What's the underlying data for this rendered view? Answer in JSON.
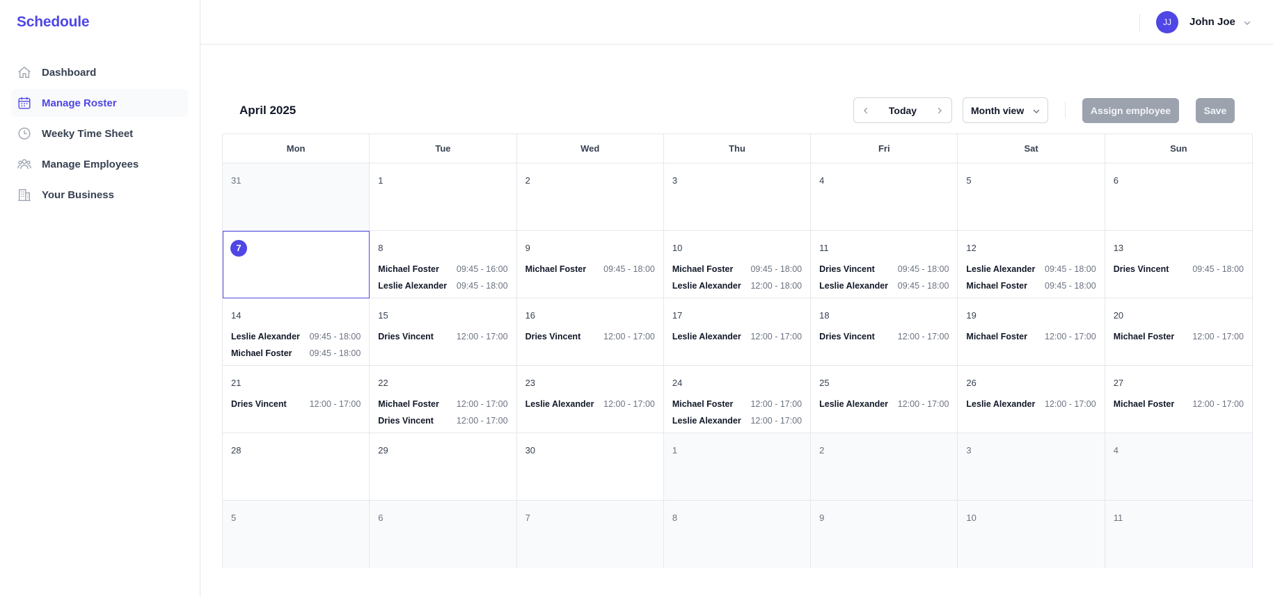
{
  "app": {
    "name": "Schedoule"
  },
  "sidebar": {
    "items": [
      {
        "label": "Dashboard",
        "icon": "home-icon",
        "active": false
      },
      {
        "label": "Manage Roster",
        "icon": "calendar-icon",
        "active": true
      },
      {
        "label": "Weeky Time Sheet",
        "icon": "clock-icon",
        "active": false
      },
      {
        "label": "Manage Employees",
        "icon": "users-icon",
        "active": false
      },
      {
        "label": "Your Business",
        "icon": "building-icon",
        "active": false
      }
    ]
  },
  "user": {
    "initials": "JJ",
    "name": "John Joe"
  },
  "calendar": {
    "title": "April 2025",
    "today_label": "Today",
    "view_label": "Month view",
    "assign_label": "Assign employee",
    "save_label": "Save",
    "weekdays": [
      "Mon",
      "Tue",
      "Wed",
      "Thu",
      "Fri",
      "Sat",
      "Sun"
    ],
    "days": [
      {
        "day": "31",
        "other": true,
        "shifts": []
      },
      {
        "day": "1",
        "shifts": []
      },
      {
        "day": "2",
        "shifts": []
      },
      {
        "day": "3",
        "shifts": []
      },
      {
        "day": "4",
        "shifts": []
      },
      {
        "day": "5",
        "shifts": []
      },
      {
        "day": "6",
        "shifts": []
      },
      {
        "day": "7",
        "today": true,
        "shifts": []
      },
      {
        "day": "8",
        "shifts": [
          {
            "name": "Michael Foster",
            "time": "09:45 - 16:00"
          },
          {
            "name": "Leslie Alexander",
            "time": "09:45 - 18:00"
          }
        ]
      },
      {
        "day": "9",
        "shifts": [
          {
            "name": "Michael Foster",
            "time": "09:45 - 18:00"
          }
        ]
      },
      {
        "day": "10",
        "shifts": [
          {
            "name": "Michael Foster",
            "time": "09:45 - 18:00"
          },
          {
            "name": "Leslie Alexander",
            "time": "12:00 - 18:00"
          }
        ]
      },
      {
        "day": "11",
        "shifts": [
          {
            "name": "Dries Vincent",
            "time": "09:45 - 18:00"
          },
          {
            "name": "Leslie Alexander",
            "time": "09:45 - 18:00"
          }
        ]
      },
      {
        "day": "12",
        "shifts": [
          {
            "name": "Leslie Alexander",
            "time": "09:45 - 18:00"
          },
          {
            "name": "Michael Foster",
            "time": "09:45 - 18:00"
          }
        ]
      },
      {
        "day": "13",
        "shifts": [
          {
            "name": "Dries Vincent",
            "time": "09:45 - 18:00"
          }
        ]
      },
      {
        "day": "14",
        "shifts": [
          {
            "name": "Leslie Alexander",
            "time": "09:45 - 18:00"
          },
          {
            "name": "Michael Foster",
            "time": "09:45 - 18:00"
          }
        ]
      },
      {
        "day": "15",
        "shifts": [
          {
            "name": "Dries Vincent",
            "time": "12:00 - 17:00"
          }
        ]
      },
      {
        "day": "16",
        "shifts": [
          {
            "name": "Dries Vincent",
            "time": "12:00 - 17:00"
          }
        ]
      },
      {
        "day": "17",
        "shifts": [
          {
            "name": "Leslie Alexander",
            "time": "12:00 - 17:00"
          }
        ]
      },
      {
        "day": "18",
        "shifts": [
          {
            "name": "Dries Vincent",
            "time": "12:00 - 17:00"
          }
        ]
      },
      {
        "day": "19",
        "shifts": [
          {
            "name": "Michael Foster",
            "time": "12:00 - 17:00"
          }
        ]
      },
      {
        "day": "20",
        "shifts": [
          {
            "name": "Michael Foster",
            "time": "12:00 - 17:00"
          }
        ]
      },
      {
        "day": "21",
        "shifts": [
          {
            "name": "Dries Vincent",
            "time": "12:00 - 17:00"
          }
        ]
      },
      {
        "day": "22",
        "shifts": [
          {
            "name": "Michael Foster",
            "time": "12:00 - 17:00"
          },
          {
            "name": "Dries Vincent",
            "time": "12:00 - 17:00"
          }
        ]
      },
      {
        "day": "23",
        "shifts": [
          {
            "name": "Leslie Alexander",
            "time": "12:00 - 17:00"
          }
        ]
      },
      {
        "day": "24",
        "shifts": [
          {
            "name": "Michael Foster",
            "time": "12:00 - 17:00"
          },
          {
            "name": "Leslie Alexander",
            "time": "12:00 - 17:00"
          }
        ]
      },
      {
        "day": "25",
        "shifts": [
          {
            "name": "Leslie Alexander",
            "time": "12:00 - 17:00"
          }
        ]
      },
      {
        "day": "26",
        "shifts": [
          {
            "name": "Leslie Alexander",
            "time": "12:00 - 17:00"
          }
        ]
      },
      {
        "day": "27",
        "shifts": [
          {
            "name": "Michael Foster",
            "time": "12:00 - 17:00"
          }
        ]
      },
      {
        "day": "28",
        "shifts": []
      },
      {
        "day": "29",
        "shifts": []
      },
      {
        "day": "30",
        "shifts": []
      },
      {
        "day": "1",
        "other": true,
        "shifts": []
      },
      {
        "day": "2",
        "other": true,
        "shifts": []
      },
      {
        "day": "3",
        "other": true,
        "shifts": []
      },
      {
        "day": "4",
        "other": true,
        "shifts": []
      },
      {
        "day": "5",
        "other": true,
        "shifts": []
      },
      {
        "day": "6",
        "other": true,
        "shifts": []
      },
      {
        "day": "7",
        "other": true,
        "shifts": []
      },
      {
        "day": "8",
        "other": true,
        "shifts": []
      },
      {
        "day": "9",
        "other": true,
        "shifts": []
      },
      {
        "day": "10",
        "other": true,
        "shifts": []
      },
      {
        "day": "11",
        "other": true,
        "shifts": []
      }
    ]
  },
  "colors": {
    "accent": "#4f46e5",
    "button_disabled": "#9ca3af",
    "other_month_bg": "#f9fafb",
    "border": "#e5e7eb"
  }
}
